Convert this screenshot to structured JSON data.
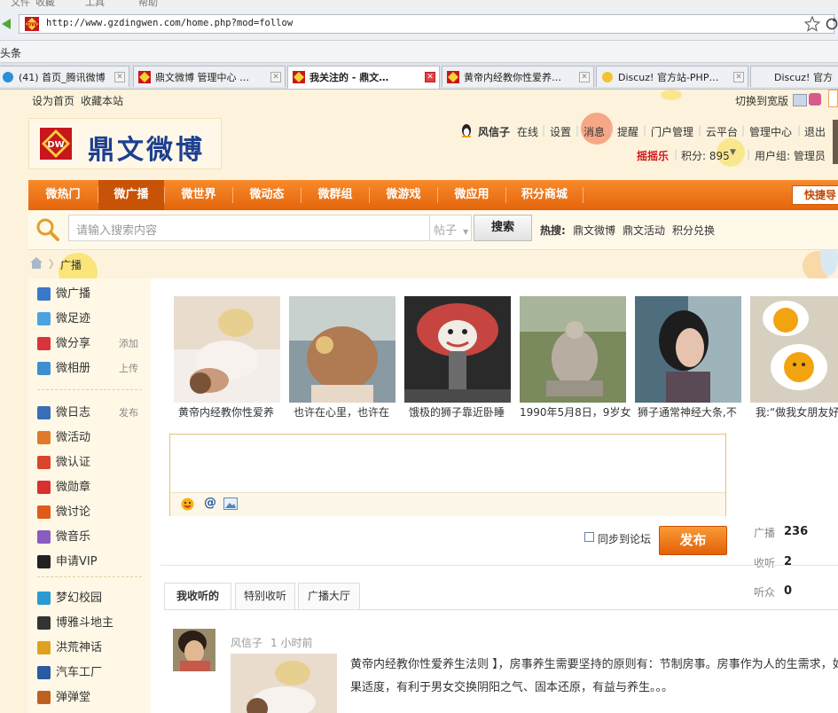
{
  "browser": {
    "menu": [
      "文件",
      "收藏",
      "工具",
      "帮助"
    ],
    "url": "http://www.gzdingwen.com/home.php?mod=follow",
    "favorites_label": "头条",
    "tabs": [
      {
        "label": "(41) 首页_腾讯微博"
      },
      {
        "label": "鼎文微博 管理中心 …"
      },
      {
        "label": "我关注的 - 鼎文…"
      },
      {
        "label": "黄帝内经教你性爱养…"
      },
      {
        "label": "Discuz! 官方站-PHP…"
      },
      {
        "label": "Discuz! 官方"
      }
    ]
  },
  "header": {
    "set_home": "设为首页",
    "bookmark": "收藏本站",
    "switch_wide": "切换到宽版",
    "logo_badge": "DW",
    "logo_text": "鼎文微博",
    "username": "风信子",
    "online": "在线",
    "links": [
      "设置",
      "消息",
      "提醒",
      "门户管理",
      "云平台",
      "管理中心",
      "退出"
    ],
    "shake": "摇摇乐",
    "points_label": "积分: 895",
    "usergroup": "用户组: 管理员"
  },
  "nav": {
    "items": [
      "微热门",
      "微广播",
      "微世界",
      "微动态",
      "微群组",
      "微游戏",
      "微应用",
      "积分商城"
    ],
    "active_index": 1,
    "quick_post": "快捷导"
  },
  "search": {
    "placeholder": "请输入搜索内容",
    "type": "帖子",
    "button": "搜索",
    "hot_label": "热搜:",
    "hot_terms": [
      "鼎文微博",
      "鼎文活动",
      "积分兑换"
    ]
  },
  "breadcrumb": {
    "current": "广播"
  },
  "sidebar": {
    "items": [
      {
        "label": "微广播",
        "icon": "broadcast-icon",
        "color": "#3a78c9"
      },
      {
        "label": "微足迹",
        "icon": "speech-bubble-icon",
        "color": "#4aa3e0"
      },
      {
        "label": "微分享",
        "icon": "heart-share-icon",
        "color": "#d9343b",
        "extra": "添加"
      },
      {
        "label": "微相册",
        "icon": "photo-icon",
        "color": "#3f8fd0",
        "extra": "上传"
      },
      {
        "label": "微日志",
        "icon": "blog-icon",
        "color": "#3a6fb8",
        "extra": "发布"
      },
      {
        "label": "微活动",
        "icon": "activity-icon",
        "color": "#e07a2a"
      },
      {
        "label": "微认证",
        "icon": "shield-icon",
        "color": "#d9462b"
      },
      {
        "label": "微勋章",
        "icon": "star-icon",
        "color": "#d93030"
      },
      {
        "label": "微讨论",
        "icon": "hot-icon",
        "color": "#e05a1a"
      },
      {
        "label": "微音乐",
        "icon": "music-icon",
        "color": "#8a5cc0"
      },
      {
        "label": "申请VIP",
        "icon": "penguin-icon",
        "color": "#222222"
      },
      {
        "label": "梦幻校园",
        "icon": "game-icon",
        "color": "#2a9ad0"
      },
      {
        "label": "博雅斗地主",
        "icon": "cards-icon",
        "color": "#333333"
      },
      {
        "label": "洪荒神话",
        "icon": "myth-icon",
        "color": "#e0a020"
      },
      {
        "label": "汽车工厂",
        "icon": "factory-icon",
        "color": "#2a5aa0"
      },
      {
        "label": "弹弹堂",
        "icon": "ddt-icon",
        "color": "#c06020"
      }
    ]
  },
  "thumbnails": [
    {
      "caption": "黄帝内经教你性爱养",
      "icon": "couple-photo"
    },
    {
      "caption": "也许在心里，也许在",
      "icon": "girl-photo"
    },
    {
      "caption": "饿极的狮子靠近卧睡",
      "icon": "clown-cloud-photo"
    },
    {
      "caption": "1990年5月8日，9岁女",
      "icon": "statue-photo"
    },
    {
      "caption": "狮子通常神经大条,不",
      "icon": "woman-photo"
    },
    {
      "caption": "我:“做我女朋友好",
      "icon": "eggs-photo"
    }
  ],
  "composer": {
    "sync_label": "同步到论坛",
    "publish_button": "发布"
  },
  "stats": [
    {
      "label": "广播",
      "value": "236"
    },
    {
      "label": "收听",
      "value": "2"
    },
    {
      "label": "听众",
      "value": "0"
    }
  ],
  "feed_tabs": [
    "我收听的",
    "特别收听",
    "广播大厅"
  ],
  "post": {
    "author": "风信子",
    "time": "1 小时前",
    "text": "黄帝内经教你性爱养生法则 】，房事养生需要坚持的原则有：节制房事。房事作为人的生需求，如果适度，有利于男女交换阴阳之气、固本还原，有益与养生。。。"
  }
}
